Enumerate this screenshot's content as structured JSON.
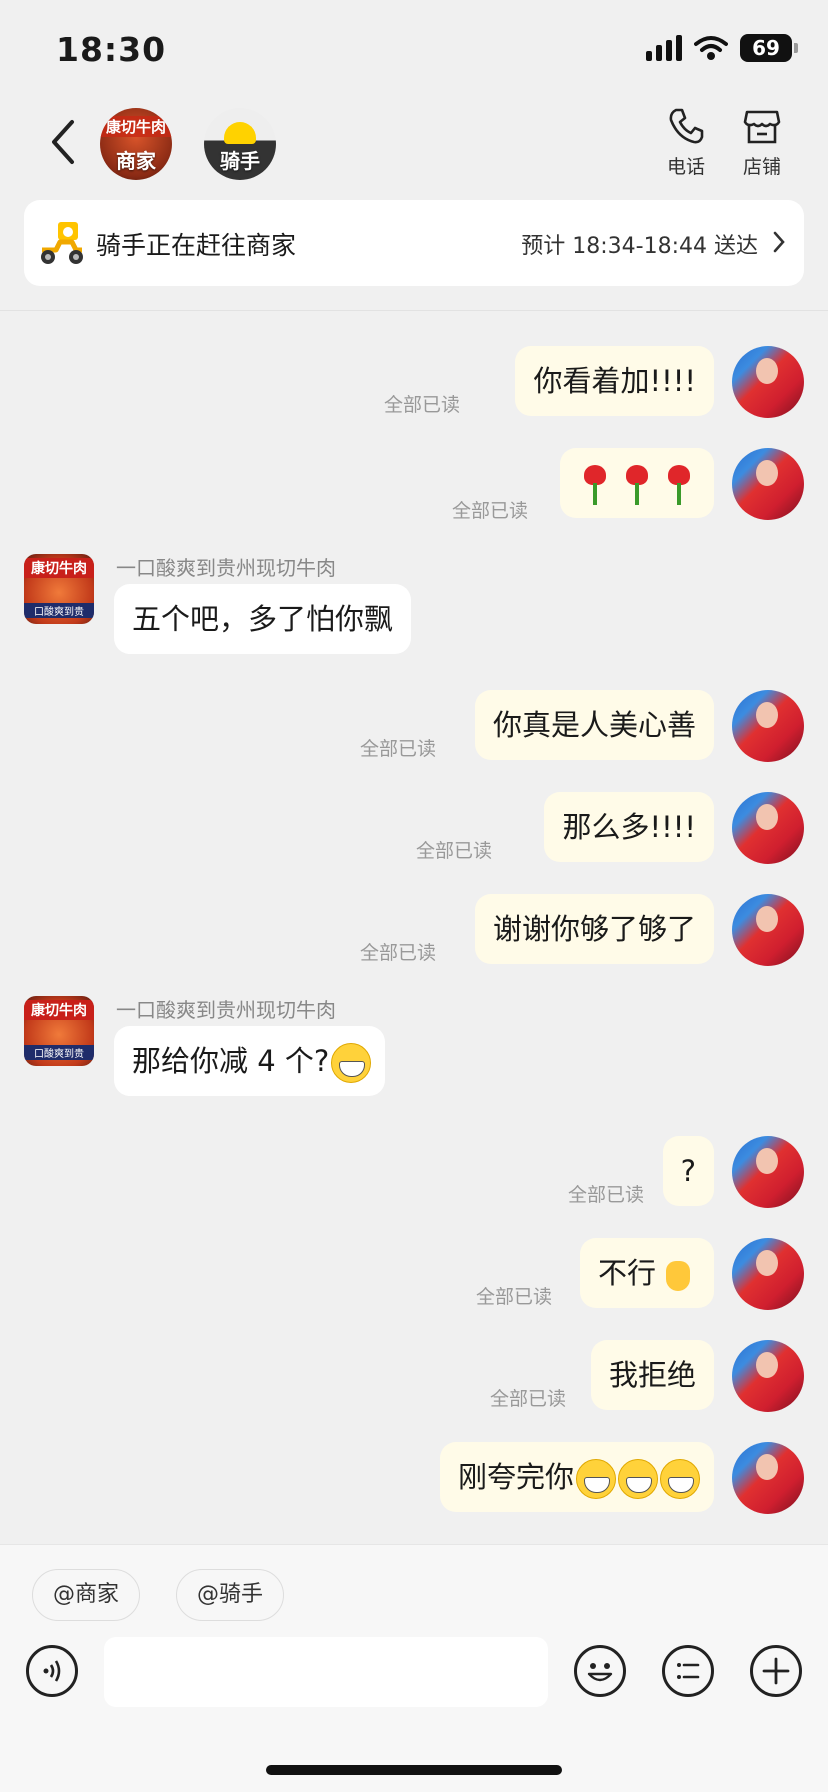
{
  "status_bar": {
    "time": "18:30",
    "battery": "69"
  },
  "header": {
    "merchant_label": "商家",
    "merchant_shop_name": "康切牛肉",
    "rider_label": "骑手",
    "phone_label": "电话",
    "store_label": "店铺"
  },
  "delivery": {
    "status": "骑手正在赶往商家",
    "eta": "预计 18:34-18:44 送达"
  },
  "read_label": "全部已读",
  "shop_name": "一口酸爽到贵州现切牛肉",
  "shop_avatar": {
    "top": "康切牛肉",
    "bottom": "口酸爽到贵"
  },
  "messages": [
    {
      "dir": "out",
      "text": "你看着加!!!!"
    },
    {
      "dir": "out",
      "text": "",
      "emoji": [
        "rose-emoji",
        "rose-emoji",
        "rose-emoji"
      ]
    },
    {
      "dir": "in",
      "text": "五个吧，多了怕你飘"
    },
    {
      "dir": "out",
      "text": "你真是人美心善"
    },
    {
      "dir": "out",
      "text": "那么多!!!!"
    },
    {
      "dir": "out",
      "text": "谢谢你够了够了"
    },
    {
      "dir": "in",
      "text": "那给你减 4 个?",
      "emoji": [
        "grin-emoji"
      ]
    },
    {
      "dir": "out",
      "text": "?"
    },
    {
      "dir": "out",
      "text": "不行",
      "emoji": [
        "hand-emoji"
      ]
    },
    {
      "dir": "out",
      "text": "我拒绝"
    },
    {
      "dir": "out",
      "text": "刚夸完你",
      "emoji": [
        "grin-emoji",
        "grin-emoji",
        "grin-emoji"
      ]
    }
  ],
  "composer": {
    "mention_merchant": "@商家",
    "mention_rider": "@骑手",
    "input_value": ""
  }
}
